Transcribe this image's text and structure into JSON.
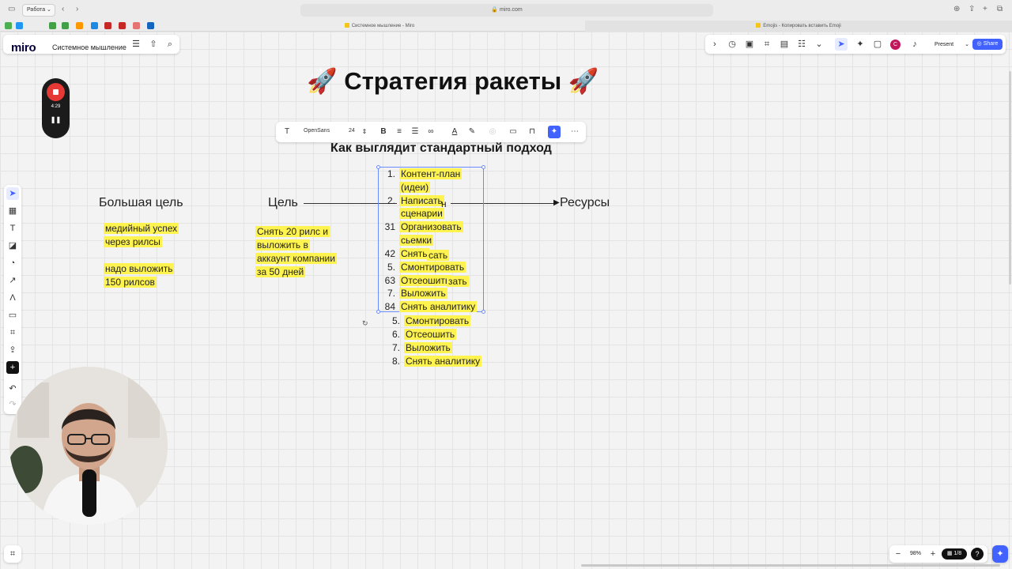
{
  "browser": {
    "profile": "Работа",
    "url": "miro.com",
    "tabs": [
      {
        "title": "Системное мышление - Miro"
      },
      {
        "title": "Emojis - Копировать вставить Emoji"
      }
    ]
  },
  "app": {
    "logo": "miro",
    "board_name": "Системное мышление",
    "present_label": "Present",
    "share_label": "Share",
    "avatar_initial": "C",
    "zoom": "98%",
    "page_counter": "1/8"
  },
  "recorder": {
    "time": "4:29"
  },
  "format_toolbar": {
    "font": "OpenSans",
    "size": "24"
  },
  "board": {
    "title": "🚀 Стратегия ракеты 🚀",
    "subtitle": "Как  выглядит стандартный подход",
    "big_goal": "Большая цель",
    "goal": "Цель",
    "resources": "Ресурсы",
    "big_goal_notes": [
      "медийный успех",
      "через рилсы",
      "надо выложить",
      "150 рилсов"
    ],
    "goal_notes": [
      "Снять 20 рилс и",
      "выложить в",
      "аккаунт компании",
      "за 50 дней"
    ],
    "list_box": [
      {
        "num": "1.",
        "lines": [
          "Контент-план",
          "(идеи)"
        ]
      },
      {
        "num": "2.",
        "lines": [
          "Написать",
          "сценарии"
        ]
      },
      {
        "num": "31",
        "lines": [
          "Организовать",
          "сьемки"
        ]
      },
      {
        "num": "42",
        "lines": [
          "Снять"
        ]
      },
      {
        "num": "5.",
        "lines": [
          "Смонтировать"
        ]
      },
      {
        "num": "63",
        "lines": [
          "Отсеошить"
        ]
      },
      {
        "num": "7.",
        "lines": [
          "Выложить"
        ]
      },
      {
        "num": "84",
        "lines": [
          "Снять аналитику"
        ]
      }
    ],
    "overlap_fragments": [
      "н",
      "сать",
      "зать"
    ],
    "list_below": [
      {
        "num": "5.",
        "text": "Смонтировать"
      },
      {
        "num": "6.",
        "text": "Отсеошить"
      },
      {
        "num": "7.",
        "text": "Выложить"
      },
      {
        "num": "8.",
        "text": "Снять аналитику"
      }
    ]
  },
  "colors": {
    "highlight": "#fff44f",
    "share": "#4262ff",
    "recorder_red": "#e53935",
    "selection": "#6b8cff"
  }
}
